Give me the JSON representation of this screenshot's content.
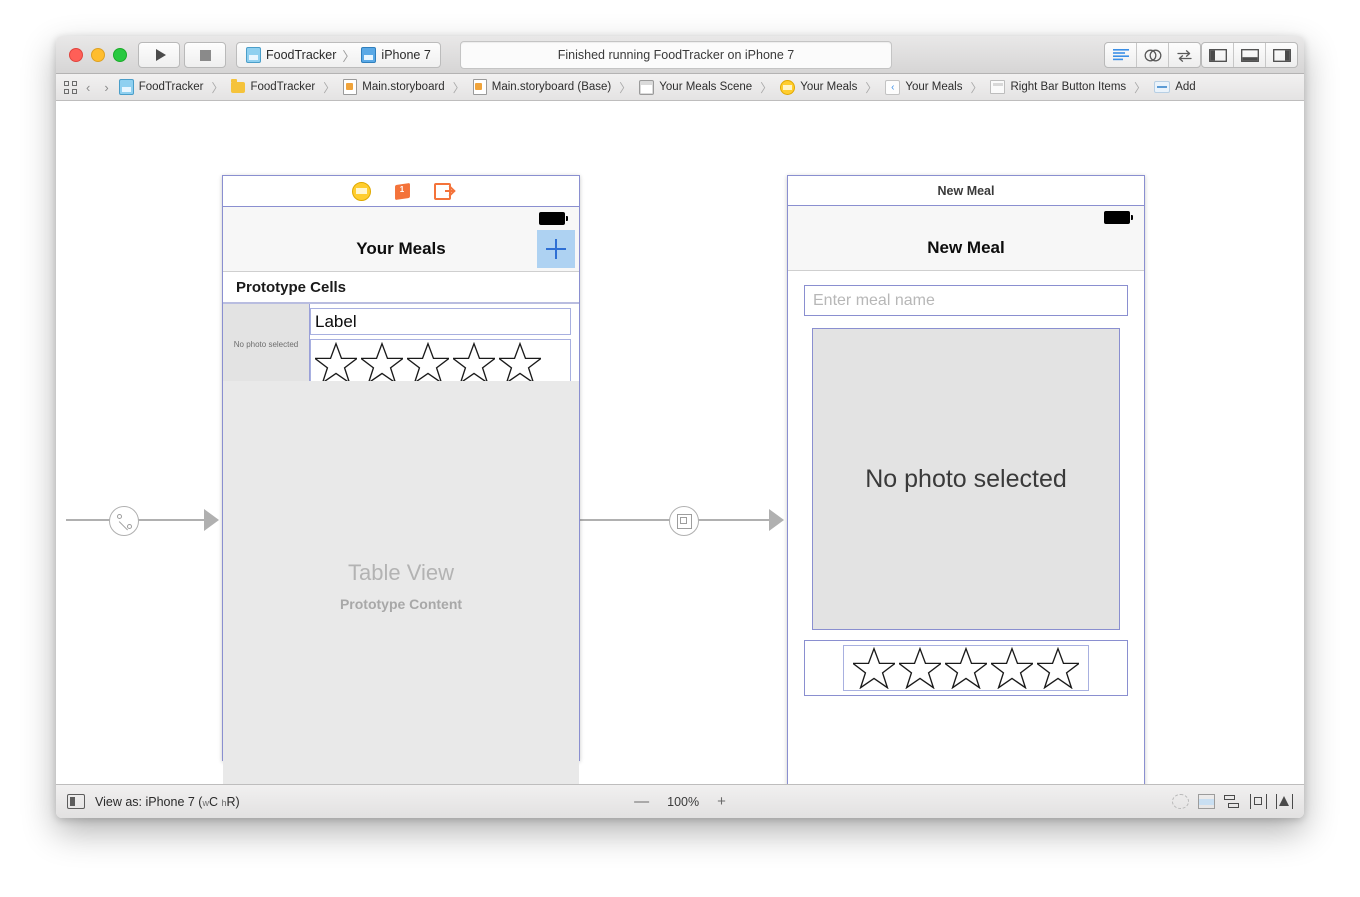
{
  "window": {
    "toolbar": {
      "run_label": "run-button",
      "stop_label": "stop-button",
      "scheme_project": "FoodTracker",
      "scheme_separator": "〉",
      "scheme_device": "iPhone 7",
      "status_text": "Finished running FoodTracker on iPhone 7",
      "editor_segments": [
        "standard-editor",
        "assistant-editor",
        "version-editor"
      ],
      "view_segments": [
        "navigator-toggle",
        "debug-toggle",
        "utilities-toggle"
      ]
    },
    "jumpbar": {
      "back_glyph": "‹",
      "forward_glyph": "›",
      "separator": "〉",
      "crumbs": [
        {
          "icon": "project-icon",
          "label": "FoodTracker"
        },
        {
          "icon": "folder-icon",
          "label": "FoodTracker"
        },
        {
          "icon": "storyboard-icon",
          "label": "Main.storyboard"
        },
        {
          "icon": "storyboard-icon",
          "label": "Main.storyboard (Base)"
        },
        {
          "icon": "scene-icon",
          "label": "Your Meals Scene"
        },
        {
          "icon": "view-controller-icon",
          "label": "Your Meals"
        },
        {
          "icon": "back-item-icon",
          "label": "Your Meals"
        },
        {
          "icon": "bar-button-items-icon",
          "label": "Right Bar Button Items"
        },
        {
          "icon": "bar-button-item-icon",
          "label": "Add"
        }
      ]
    },
    "canvas": {
      "scene_left": {
        "dock_icons": [
          "view-controller-icon",
          "first-responder-icon",
          "exit-icon"
        ],
        "first_responder_glyph": "1",
        "nav_title": "Your Meals",
        "add_button": "+",
        "section_header": "Prototype Cells",
        "cell": {
          "thumb_text": "No photo selected",
          "label_text": "Label",
          "star_count": 5
        },
        "table_title": "Table View",
        "table_subtitle": "Prototype Content"
      },
      "scene_right": {
        "scene_label": "New Meal",
        "nav_title": "New Meal",
        "name_placeholder": "Enter meal name",
        "photo_text": "No photo selected",
        "star_count": 5
      },
      "segues": [
        {
          "name": "entry-point-segue",
          "badge": "relationship-segue-icon"
        },
        {
          "name": "present-modally-segue",
          "badge": "modal-segue-icon"
        }
      ]
    },
    "bottombar": {
      "view_as_prefix": "View as: iPhone 7 (",
      "view_as_w": "w",
      "view_as_wclass": "C",
      "view_as_h": "h",
      "view_as_hclass": "R",
      "view_as_suffix": ")",
      "zoom_out": "—",
      "zoom_level": "100%",
      "zoom_in": "+",
      "autolayout_icons": [
        "update-frames-icon",
        "embed-in-icon",
        "align-icon",
        "pin-icon",
        "resolve-issues-icon"
      ]
    }
  },
  "colors": {
    "selection_blue": "#8a8fd0",
    "accent_blue": "#2e6fd4",
    "dock_yellow": "#ffcd2e",
    "dock_orange": "#f4733a"
  }
}
